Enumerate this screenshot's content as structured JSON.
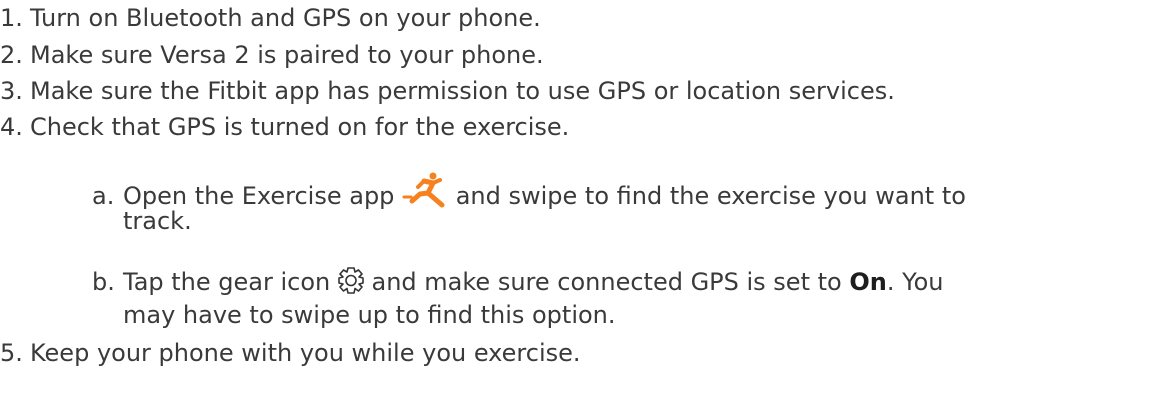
{
  "steps": {
    "s1": {
      "marker": "1.",
      "text": "Turn on Bluetooth and GPS on your phone."
    },
    "s2": {
      "marker": "2.",
      "text": "Make sure Versa 2 is paired to your phone."
    },
    "s3": {
      "marker": "3.",
      "text": "Make sure the Fitbit app has permission to use GPS or location services."
    },
    "s4": {
      "marker": "4.",
      "text": "Check that GPS is turned on for the exercise."
    },
    "s5": {
      "marker": "5.",
      "text": "Keep your phone with you while you exercise."
    }
  },
  "substeps": {
    "a": {
      "marker": "a.",
      "before_icon": "Open the Exercise app",
      "after_icon": "and swipe to find the exercise you want to",
      "cont": "track.",
      "icon": "runner-icon",
      "icon_color": "#f5821f"
    },
    "b": {
      "marker": "b.",
      "before_icon": "Tap the gear icon",
      "after_icon": "and make sure connected GPS is set to",
      "bold": "On",
      "after_bold": ". You",
      "cont": "may have to swipe up to find this option.",
      "icon": "gear-icon"
    }
  }
}
